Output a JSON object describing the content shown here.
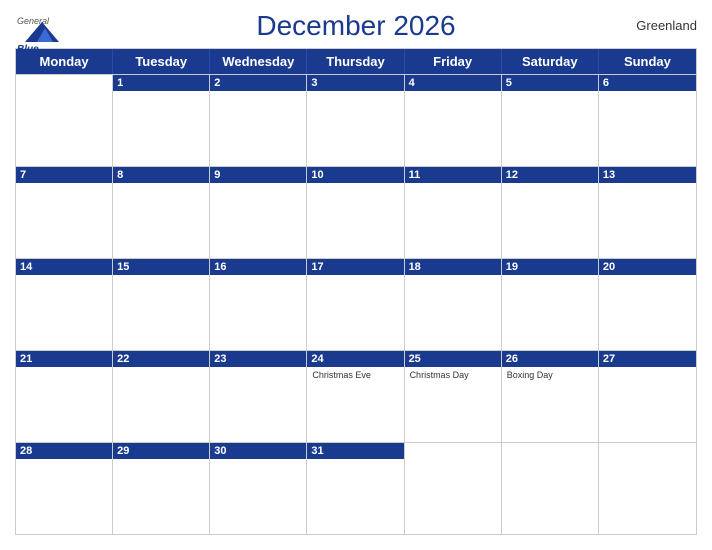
{
  "header": {
    "logo_general": "General",
    "logo_blue": "Blue",
    "title": "December 2026",
    "region": "Greenland"
  },
  "day_headers": [
    "Monday",
    "Tuesday",
    "Wednesday",
    "Thursday",
    "Friday",
    "Saturday",
    "Sunday"
  ],
  "weeks": [
    [
      {
        "day": "",
        "holiday": ""
      },
      {
        "day": "1",
        "holiday": ""
      },
      {
        "day": "2",
        "holiday": ""
      },
      {
        "day": "3",
        "holiday": ""
      },
      {
        "day": "4",
        "holiday": ""
      },
      {
        "day": "5",
        "holiday": ""
      },
      {
        "day": "6",
        "holiday": ""
      }
    ],
    [
      {
        "day": "7",
        "holiday": ""
      },
      {
        "day": "8",
        "holiday": ""
      },
      {
        "day": "9",
        "holiday": ""
      },
      {
        "day": "10",
        "holiday": ""
      },
      {
        "day": "11",
        "holiday": ""
      },
      {
        "day": "12",
        "holiday": ""
      },
      {
        "day": "13",
        "holiday": ""
      }
    ],
    [
      {
        "day": "14",
        "holiday": ""
      },
      {
        "day": "15",
        "holiday": ""
      },
      {
        "day": "16",
        "holiday": ""
      },
      {
        "day": "17",
        "holiday": ""
      },
      {
        "day": "18",
        "holiday": ""
      },
      {
        "day": "19",
        "holiday": ""
      },
      {
        "day": "20",
        "holiday": ""
      }
    ],
    [
      {
        "day": "21",
        "holiday": ""
      },
      {
        "day": "22",
        "holiday": ""
      },
      {
        "day": "23",
        "holiday": ""
      },
      {
        "day": "24",
        "holiday": "Christmas Eve"
      },
      {
        "day": "25",
        "holiday": "Christmas Day"
      },
      {
        "day": "26",
        "holiday": "Boxing Day"
      },
      {
        "day": "27",
        "holiday": ""
      }
    ],
    [
      {
        "day": "28",
        "holiday": ""
      },
      {
        "day": "29",
        "holiday": ""
      },
      {
        "day": "30",
        "holiday": ""
      },
      {
        "day": "31",
        "holiday": ""
      },
      {
        "day": "",
        "holiday": ""
      },
      {
        "day": "",
        "holiday": ""
      },
      {
        "day": "",
        "holiday": ""
      }
    ]
  ],
  "colors": {
    "header_bg": "#1a3a8f",
    "header_text": "#ffffff",
    "title_color": "#1a3a8f"
  }
}
